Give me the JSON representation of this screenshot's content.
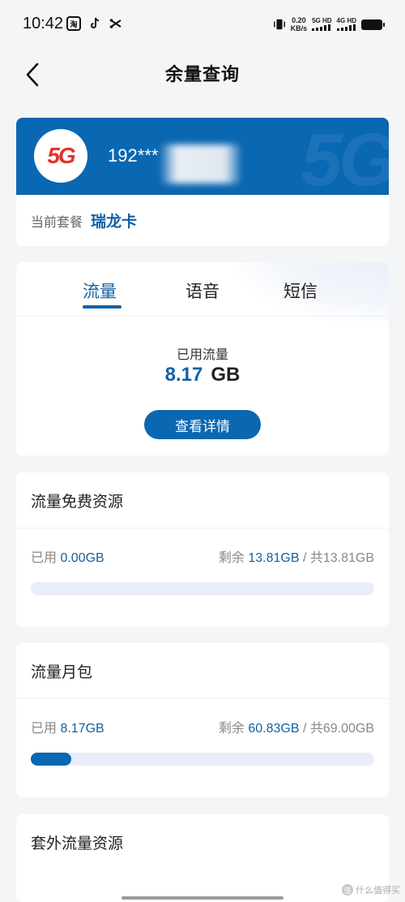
{
  "status_bar": {
    "time": "10:42",
    "speed_value": "0.20",
    "speed_unit": "KB/s",
    "sim1": "5G HD",
    "sim2": "4G HD"
  },
  "header": {
    "title": "余量查询"
  },
  "plan": {
    "phone_number": "192***",
    "label": "当前套餐",
    "name": "瑞龙卡",
    "logo_text": "5G",
    "banner_bg_text": "5G"
  },
  "usage": {
    "tabs": [
      {
        "label": "流量"
      },
      {
        "label": "语音"
      },
      {
        "label": "短信"
      }
    ],
    "active_tab": "流量",
    "used_label": "已用流量",
    "used_value": "8.17",
    "used_unit": "GB",
    "detail_button": "查看详情"
  },
  "resources": [
    {
      "title": "流量免费资源",
      "used_prefix": "已用 ",
      "used_value": "0.00GB",
      "remain_prefix": "剩余 ",
      "remain_value": "13.81GB",
      "total_text": " / 共13.81GB",
      "used_fraction": 0.0
    },
    {
      "title": "流量月包",
      "used_prefix": "已用 ",
      "used_value": "8.17GB",
      "remain_prefix": "剩余 ",
      "remain_value": "60.83GB",
      "total_text": " / 共69.00GB",
      "used_fraction": 0.1184
    },
    {
      "title": "套外流量资源"
    }
  ],
  "watermark": "什么值得买",
  "colors": {
    "primary": "#0a67b2",
    "accent_text": "#1262a3",
    "logo_red": "#e5312a"
  }
}
